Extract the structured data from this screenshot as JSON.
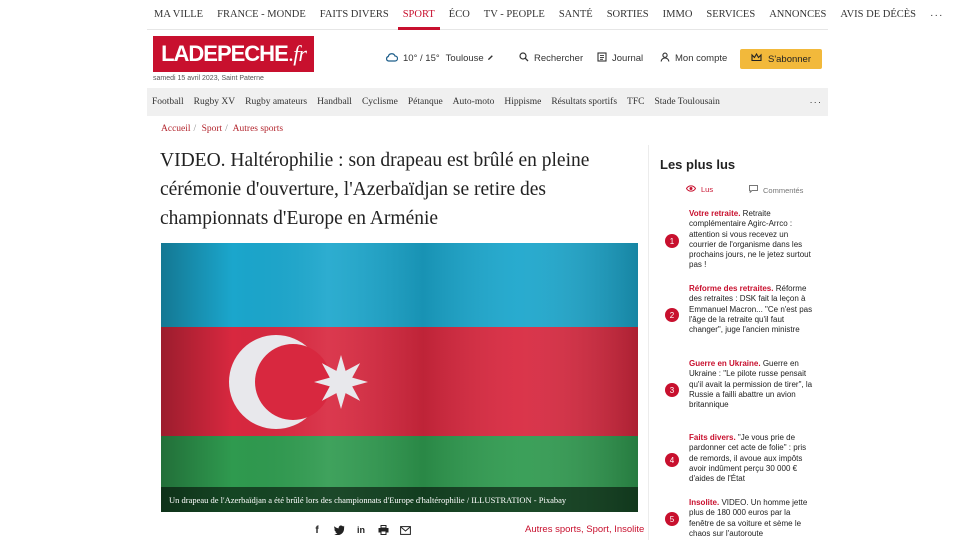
{
  "top_nav": {
    "items": [
      "MA VILLE",
      "FRANCE - MONDE",
      "FAITS DIVERS",
      "SPORT",
      "ÉCO",
      "TV - PEOPLE",
      "SANTÉ",
      "SORTIES",
      "IMMO",
      "SERVICES",
      "ANNONCES",
      "AVIS DE DÉCÈS"
    ],
    "more": "···"
  },
  "header": {
    "logo_main": "LADEPECHE",
    "logo_suffix": ".fr",
    "date": "samedi 15 avril 2023, Saint Paterne",
    "weather": "10° / 15°",
    "city": "Toulouse",
    "search": "Rechercher",
    "journal": "Journal",
    "account": "Mon compte",
    "subscribe": "S'abonner"
  },
  "sport_nav": {
    "items": [
      "Football",
      "Rugby XV",
      "Rugby amateurs",
      "Handball",
      "Cyclisme",
      "Pétanque",
      "Auto-moto",
      "Hippisme",
      "Résultats sportifs",
      "TFC",
      "Stade Toulousain"
    ],
    "more": "···"
  },
  "breadcrumb": [
    "Accueil",
    "Sport",
    "Autres sports"
  ],
  "article": {
    "title": "VIDEO. Haltérophilie : son drapeau est brûlé en pleine cérémonie d'ouverture, l'Azerbaïdjan se retire des championnats d'Europe en Arménie",
    "caption": "Un drapeau de l'Azerbaïdjan a été brûlé lors des championnats d'Europe d'haltérophilie  / ILLUSTRATION - Pixabay",
    "tags": "Autres sports, Sport, Insolite"
  },
  "sidebar": {
    "title": "Les plus lus",
    "tab_read": "Lus",
    "tab_commented": "Commentés",
    "items": [
      {
        "num": "1",
        "category": "Votre retraite.",
        "text": "Retraite complémentaire Agirc-Arrco : attention si vous recevez un courrier de l'organisme dans les prochains jours, ne le jetez surtout pas !"
      },
      {
        "num": "2",
        "category": "Réforme des retraites.",
        "text": "Réforme des retraites : DSK fait la leçon à Emmanuel Macron... \"Ce n'est pas l'âge de la retraite qu'il faut changer\", juge l'ancien ministre"
      },
      {
        "num": "3",
        "category": "Guerre en Ukraine.",
        "text": "Guerre en Ukraine : \"Le pilote russe pensait qu'il avait la permission de tirer\", la Russie a failli abattre un avion britannique"
      },
      {
        "num": "4",
        "category": "Faits divers.",
        "text": "\"Je vous prie de pardonner cet acte de folie\" : pris de remords, il avoue aux impôts avoir indûment perçu 30 000 € d'aides de l'État"
      },
      {
        "num": "5",
        "category": "Insolite.",
        "text": "VIDEO. Un homme jette plus de 180 000 euros par la fenêtre de sa voiture et sème le chaos sur l'autoroute"
      }
    ]
  },
  "colors": {
    "brand_red": "#c8102e",
    "subscribe_yellow": "#f2b93b",
    "flag_blue": "#1ba6cc",
    "flag_red": "#d8283f",
    "flag_green": "#2f9a4f"
  }
}
